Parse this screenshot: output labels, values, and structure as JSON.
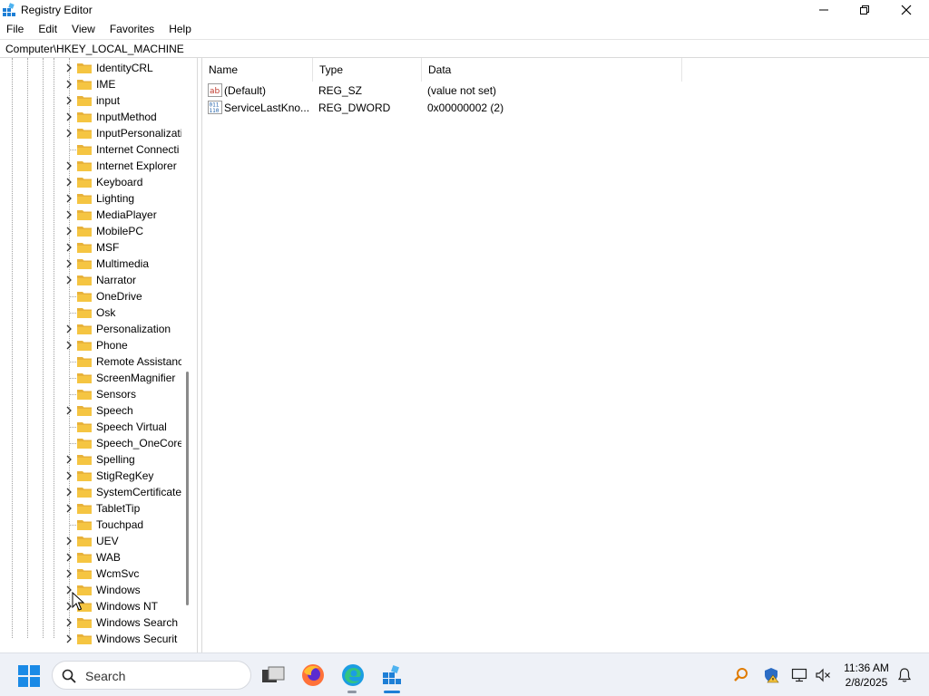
{
  "window": {
    "title": "Registry Editor",
    "controls": {
      "minimize": "minimize",
      "maximize": "restore",
      "close": "close"
    }
  },
  "menubar": {
    "items": [
      {
        "label": "File"
      },
      {
        "label": "Edit"
      },
      {
        "label": "View"
      },
      {
        "label": "Favorites"
      },
      {
        "label": "Help"
      }
    ]
  },
  "address": {
    "path": "Computer\\HKEY_LOCAL_MACHINE"
  },
  "tree": {
    "items": [
      {
        "label": "IdentityCRL",
        "expandable": true
      },
      {
        "label": "IME",
        "expandable": true
      },
      {
        "label": "input",
        "expandable": true
      },
      {
        "label": "InputMethod",
        "expandable": true
      },
      {
        "label": "InputPersonalizati",
        "expandable": true
      },
      {
        "label": "Internet Connecti",
        "expandable": false
      },
      {
        "label": "Internet Explorer",
        "expandable": true
      },
      {
        "label": "Keyboard",
        "expandable": true
      },
      {
        "label": "Lighting",
        "expandable": true
      },
      {
        "label": "MediaPlayer",
        "expandable": true
      },
      {
        "label": "MobilePC",
        "expandable": true
      },
      {
        "label": "MSF",
        "expandable": true
      },
      {
        "label": "Multimedia",
        "expandable": true
      },
      {
        "label": "Narrator",
        "expandable": true
      },
      {
        "label": "OneDrive",
        "expandable": false
      },
      {
        "label": "Osk",
        "expandable": false
      },
      {
        "label": "Personalization",
        "expandable": true
      },
      {
        "label": "Phone",
        "expandable": true
      },
      {
        "label": "Remote Assistanc",
        "expandable": false
      },
      {
        "label": "ScreenMagnifier",
        "expandable": false
      },
      {
        "label": "Sensors",
        "expandable": false
      },
      {
        "label": "Speech",
        "expandable": true
      },
      {
        "label": "Speech Virtual",
        "expandable": false
      },
      {
        "label": "Speech_OneCore",
        "expandable": false
      },
      {
        "label": "Spelling",
        "expandable": true
      },
      {
        "label": "StigRegKey",
        "expandable": true
      },
      {
        "label": "SystemCertificate",
        "expandable": true
      },
      {
        "label": "TabletTip",
        "expandable": true
      },
      {
        "label": "Touchpad",
        "expandable": false
      },
      {
        "label": "UEV",
        "expandable": true
      },
      {
        "label": "WAB",
        "expandable": true
      },
      {
        "label": "WcmSvc",
        "expandable": true
      },
      {
        "label": "Windows",
        "expandable": true
      },
      {
        "label": "Windows NT",
        "expandable": true
      },
      {
        "label": "Windows Search",
        "expandable": true
      },
      {
        "label": "Windows Securit",
        "expandable": true
      }
    ]
  },
  "values": {
    "columns": {
      "name": "Name",
      "type": "Type",
      "data": "Data"
    },
    "rows": [
      {
        "icon": "string-value-icon",
        "name": "(Default)",
        "type": "REG_SZ",
        "data": "(value not set)"
      },
      {
        "icon": "binary-value-icon",
        "name": "ServiceLastKno...",
        "type": "REG_DWORD",
        "data": "0x00000002 (2)"
      }
    ]
  },
  "taskbar": {
    "search_label": "Search",
    "apps": [
      {
        "name": "task-view",
        "icon": "task-view-icon"
      },
      {
        "name": "firefox",
        "icon": "firefox-icon"
      },
      {
        "name": "edge",
        "icon": "edge-icon"
      },
      {
        "name": "registry-editor",
        "icon": "regedit-icon"
      }
    ],
    "tray": {
      "time": "11:36 AM",
      "date": "2/8/2025"
    }
  },
  "colors": {
    "accent": "#0078d4",
    "folder": "#f5c542",
    "taskbar": "#eef1f7"
  }
}
